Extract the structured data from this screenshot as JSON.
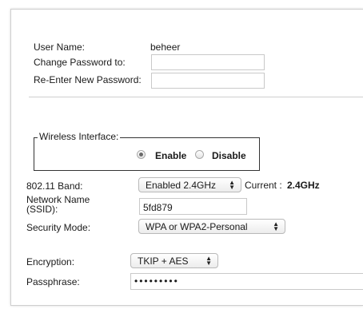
{
  "account": {
    "user_name_label": "User Name:",
    "user_name_value": "beheer",
    "change_password_label": "Change Password to:",
    "change_password_value": "",
    "reenter_password_label": "Re-Enter New Password:",
    "reenter_password_value": ""
  },
  "wireless": {
    "interface_legend": "Wireless Interface:",
    "enable_label": "Enable",
    "disable_label": "Disable",
    "selected": "Enable",
    "band_label": "802.11 Band:",
    "band_value": "Enabled 2.4GHz",
    "current_label": "Current :",
    "current_value": "2.4GHz",
    "network_name_label_line1": "Network Name",
    "network_name_label_line2": "(SSID):",
    "ssid_value": "5fd879",
    "security_mode_label": "Security Mode:",
    "security_mode_value": "WPA or WPA2-Personal",
    "encryption_label": "Encryption:",
    "encryption_value": "TKIP + AES",
    "passphrase_label": "Passphrase:",
    "passphrase_value": "•••••••••"
  },
  "icons": {
    "select_arrows": "updown-arrows-icon"
  }
}
